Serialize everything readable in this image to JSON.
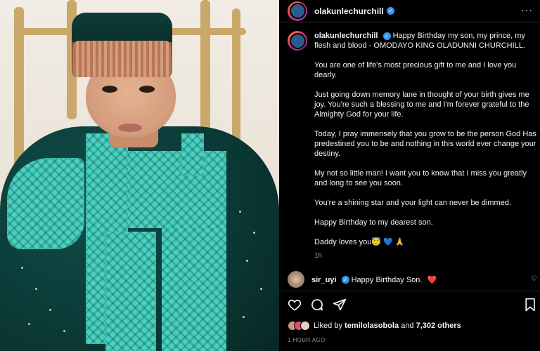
{
  "post": {
    "username": "olakunlechurchill",
    "more_icon": "more-options-icon",
    "time_ago": "1h",
    "timestamp": "1 HOUR AGO"
  },
  "caption": {
    "first_line": "Happy Birthday my son, my prince, my flesh and blood - OMODAYO KING OLADUNNI CHURCHILL.",
    "paragraphs": [
      "You are one of life's most precious gift to me and I love you dearly.",
      "Just going down memory lane in thought of your birth gives me joy. You're such a blessing to me and I'm forever grateful to the Almighty God for your life.",
      "Today, I pray immensely that you grow to be the person God Has predestined you to be and nothing in this world ever change your destiny.",
      "My not so little man! I want you to know that I miss you greatly and long to see you soon.",
      "You're a shining star and your light can never be dimmed.",
      "Happy Birthday to my dearest son.",
      "Daddy loves you😇 💙 🙏"
    ]
  },
  "comment": {
    "username": "sir_uyi",
    "text": "Happy Birthday Son.",
    "emoji": "❤️"
  },
  "likes": {
    "prefix": "Liked by",
    "user": "temilolasobola",
    "and": "and",
    "count": "7,302 others"
  },
  "colors": {
    "background": "#000000",
    "verified": "#3897f0",
    "heart": "#ed4956"
  }
}
